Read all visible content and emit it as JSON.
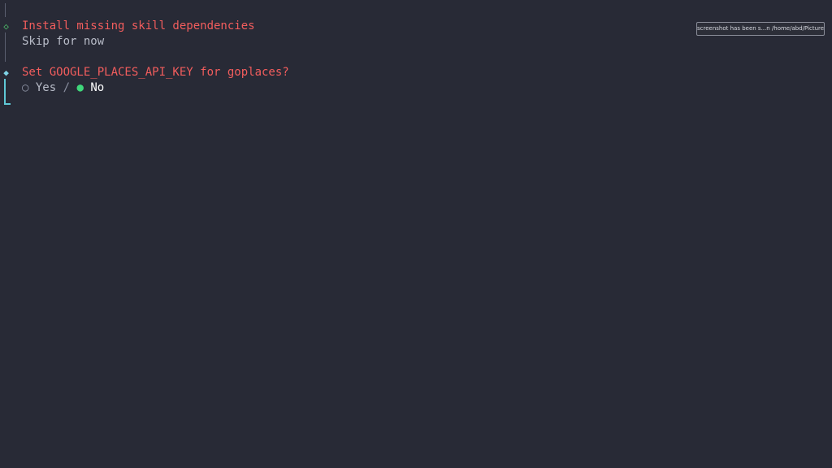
{
  "steps": [
    {
      "marker": "◇",
      "title": "Install missing skill dependencies",
      "answer": "Skip for now"
    },
    {
      "marker": "◆",
      "title": "Set GOOGLE_PLACES_API_KEY for goplaces?",
      "options": {
        "yes": {
          "symbol": "○",
          "label": "Yes"
        },
        "separator": "/",
        "no": {
          "symbol": "●",
          "label": "No"
        }
      }
    }
  ],
  "notification": {
    "text": "screenshot has been s...n /home/abd/Pictures"
  },
  "colors": {
    "background": "#282a36",
    "prompt": "#f25d5d",
    "selected": "#3fd77a",
    "rail": "#5fc8d6"
  }
}
